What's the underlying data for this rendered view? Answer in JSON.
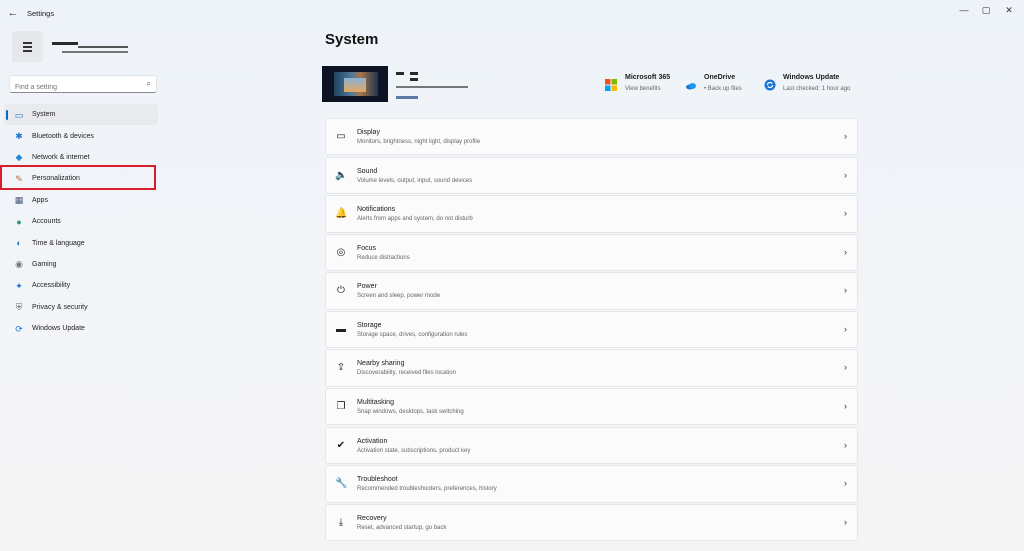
{
  "window": {
    "title": "Settings",
    "back_glyph": "←",
    "min_glyph": "—",
    "max_glyph": "▢",
    "close_glyph": "✕"
  },
  "search": {
    "placeholder": "Find a setting",
    "icon": "search-icon"
  },
  "sidebar": {
    "items": [
      {
        "label": "System",
        "icon": "system-icon",
        "glyph": "▭",
        "color": "#1f6fc5",
        "selected": true
      },
      {
        "label": "Bluetooth & devices",
        "icon": "bluetooth-icon",
        "glyph": "✱",
        "color": "#1a73d6"
      },
      {
        "label": "Network & internet",
        "icon": "wifi-icon",
        "glyph": "◆",
        "color": "#2585d9"
      },
      {
        "label": "Personalization",
        "icon": "brush-icon",
        "glyph": "✎",
        "color": "#c06a3a"
      },
      {
        "label": "Apps",
        "icon": "apps-icon",
        "glyph": "▦",
        "color": "#4a5a78"
      },
      {
        "label": "Accounts",
        "icon": "person-icon",
        "glyph": "●",
        "color": "#1f9e7a"
      },
      {
        "label": "Time & language",
        "icon": "globe-clock-icon",
        "glyph": "◐",
        "color": "#1e86c8"
      },
      {
        "label": "Gaming",
        "icon": "gamepad-icon",
        "glyph": "◉",
        "color": "#6b7785"
      },
      {
        "label": "Accessibility",
        "icon": "accessibility-icon",
        "glyph": "✦",
        "color": "#1a73d6"
      },
      {
        "label": "Privacy & security",
        "icon": "shield-icon",
        "glyph": "⛨",
        "color": "#5f6a78"
      },
      {
        "label": "Windows Update",
        "icon": "sync-icon",
        "glyph": "⟳",
        "color": "#1a73d6"
      }
    ]
  },
  "main": {
    "title": "System",
    "quick_links": [
      {
        "title": "Microsoft 365",
        "sub": "View benefits",
        "icon": "microsoft-logo-icon"
      },
      {
        "title": "OneDrive",
        "sub": "• Back up files",
        "icon": "cloud-icon"
      },
      {
        "title": "Windows Update",
        "sub": "Last checked: 1 hour ago",
        "icon": "windows-update-icon"
      }
    ],
    "cards": [
      {
        "title": "Display",
        "sub": "Monitors, brightness, night light, display profile",
        "icon": "monitor-icon",
        "glyph": "▭"
      },
      {
        "title": "Sound",
        "sub": "Volume levels, output, input, sound devices",
        "icon": "speaker-icon",
        "glyph": "🔈"
      },
      {
        "title": "Notifications",
        "sub": "Alerts from apps and system, do not disturb",
        "icon": "bell-icon",
        "glyph": "🔔"
      },
      {
        "title": "Focus",
        "sub": "Reduce distractions",
        "icon": "focus-icon",
        "glyph": "◎"
      },
      {
        "title": "Power",
        "sub": "Screen and sleep, power mode",
        "icon": "power-icon",
        "glyph": "⏻"
      },
      {
        "title": "Storage",
        "sub": "Storage space, drives, configuration rules",
        "icon": "storage-icon",
        "glyph": "▬"
      },
      {
        "title": "Nearby sharing",
        "sub": "Discoverability, received files location",
        "icon": "share-icon",
        "glyph": "⇪"
      },
      {
        "title": "Multitasking",
        "sub": "Snap windows, desktops, task switching",
        "icon": "multitask-icon",
        "glyph": "❐"
      },
      {
        "title": "Activation",
        "sub": "Activation state, subscriptions, product key",
        "icon": "check-circle-icon",
        "glyph": "✔"
      },
      {
        "title": "Troubleshoot",
        "sub": "Recommended troubleshooters, preferences, history",
        "icon": "wrench-icon",
        "glyph": "🔧"
      },
      {
        "title": "Recovery",
        "sub": "Reset, advanced startup, go back",
        "icon": "recovery-icon",
        "glyph": "⤓"
      }
    ],
    "chevron_glyph": "›"
  },
  "colors": {
    "accent": "#0a67c2",
    "highlight_box": "#d51f2a"
  }
}
